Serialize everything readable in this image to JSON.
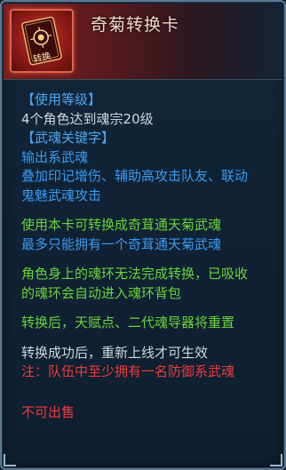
{
  "item": {
    "name": "奇菊转换卡",
    "icon": "card-icon",
    "icon_label": "转换"
  },
  "sections": {
    "level_header": "【使用等级】",
    "level_value": "4个角色达到魂宗20级",
    "keyword_header": "【武魂关键字】",
    "keyword_lines": [
      "输出系武魂",
      "叠加印记增伤、辅助高攻击队友、联动",
      "鬼魅武魂攻击"
    ]
  },
  "desc": {
    "convert_line": "使用本卡可转换成奇茸通天菊武魂",
    "limit_line": "最多只能拥有一个奇茸通天菊武魂",
    "ring_lines": [
      "角色身上的魂环无法完成转换，已吸收",
      "的魂环会自动进入魂环背包"
    ],
    "reset_line": "转换后，天赋点、二代魂导器将重置",
    "relogin_line": "转换成功后，重新上线才可生效",
    "note_line": "注：队伍中至少拥有一名防御系武魂"
  },
  "footer": {
    "untradable": "不可出售"
  },
  "colors": {
    "section_blue": "#4ea6f0",
    "white": "#cfd6de",
    "blue": "#3a9af0",
    "green": "#6ad33a",
    "red": "#f03a3a"
  }
}
